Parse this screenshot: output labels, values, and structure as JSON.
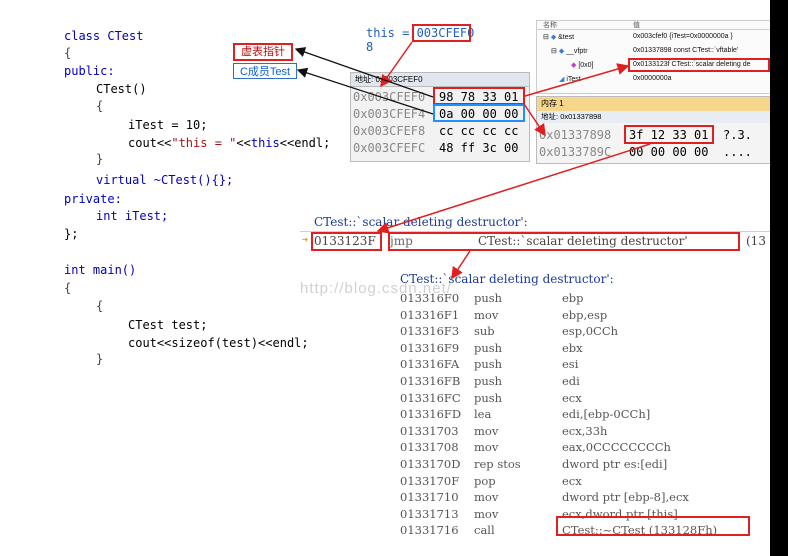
{
  "code": {
    "lines": [
      "class CTest",
      "{",
      "public:",
      "CTest()",
      "{",
      "iTest = 10;",
      "cout<<\"this = \"<<this<<endl;",
      "}",
      "virtual ~CTest(){};",
      "private:",
      "int iTest;",
      "};",
      "int main()",
      "{",
      "{",
      "CTest test;",
      "cout<<sizeof(test)<<endl;",
      "}"
    ]
  },
  "this_output": {
    "line1": "this = 003CFEF0",
    "line2": "8"
  },
  "annotations": {
    "vptr_label": "虚表指针",
    "member_label": "C成员Test"
  },
  "memory1": {
    "address_label": "地址:",
    "address_value": "0x003CFEF0",
    "rows": [
      {
        "addr": "0x003CFEF0",
        "bytes": "98 78 33 01"
      },
      {
        "addr": "0x003CFEF4",
        "bytes": "0a 00 00 00"
      },
      {
        "addr": "0x003CFEF8",
        "bytes": "cc cc cc cc"
      },
      {
        "addr": "0x003CFEFC",
        "bytes": "48 ff 3c 00"
      }
    ]
  },
  "watch": {
    "header_name": "名称",
    "header_value": "值",
    "rows": [
      {
        "name": "&test",
        "value": "0x003cfef0 {iTest=0x0000000a }"
      },
      {
        "name": "__vfptr",
        "value": "0x01337898 const CTest::`vftable'"
      },
      {
        "name": "[0x0]",
        "value": "0x0133123f CTest::`scalar deleting de"
      },
      {
        "name": "iTest",
        "value": "0x0000000a"
      }
    ]
  },
  "memory2": {
    "title": "内存 1",
    "address_label": "地址:",
    "address_value": "0x01337898",
    "rows": [
      {
        "addr": "0x01337898",
        "bytes": "3f 12 33 01",
        "ascii": "?.3."
      },
      {
        "addr": "0x0133789C",
        "bytes": "00 00 00 00",
        "ascii": "...."
      }
    ]
  },
  "jump": {
    "header": "CTest::`scalar deleting destructor':",
    "addr": "0133123F",
    "op": "jmp",
    "target": "CTest::`scalar deleting destructor'",
    "suffix": "(13"
  },
  "watermark": "http://blog.csdn.net/",
  "disasm": {
    "header": "CTest::`scalar deleting destructor':",
    "rows": [
      {
        "addr": "013316F0",
        "op": "push",
        "arg": "ebp"
      },
      {
        "addr": "013316F1",
        "op": "mov",
        "arg": "ebp,esp"
      },
      {
        "addr": "013316F3",
        "op": "sub",
        "arg": "esp,0CCh"
      },
      {
        "addr": "013316F9",
        "op": "push",
        "arg": "ebx"
      },
      {
        "addr": "013316FA",
        "op": "push",
        "arg": "esi"
      },
      {
        "addr": "013316FB",
        "op": "push",
        "arg": "edi"
      },
      {
        "addr": "013316FC",
        "op": "push",
        "arg": "ecx"
      },
      {
        "addr": "013316FD",
        "op": "lea",
        "arg": "edi,[ebp-0CCh]"
      },
      {
        "addr": "01331703",
        "op": "mov",
        "arg": "ecx,33h"
      },
      {
        "addr": "01331708",
        "op": "mov",
        "arg": "eax,0CCCCCCCCh"
      },
      {
        "addr": "0133170D",
        "op": "rep stos",
        "arg": "dword ptr es:[edi]"
      },
      {
        "addr": "0133170F",
        "op": "pop",
        "arg": "ecx"
      },
      {
        "addr": "01331710",
        "op": "mov",
        "arg": "dword ptr [ebp-8],ecx"
      },
      {
        "addr": "01331713",
        "op": "mov",
        "arg": "ecx,dword ptr [this]"
      },
      {
        "addr": "01331716",
        "op": "call",
        "arg": "CTest::~CTest (133128Fh)"
      }
    ]
  },
  "colors": {
    "annotation_red": "#e02020",
    "highlight_blue": "#1e90ff",
    "keyword_blue": "#0000c0"
  }
}
